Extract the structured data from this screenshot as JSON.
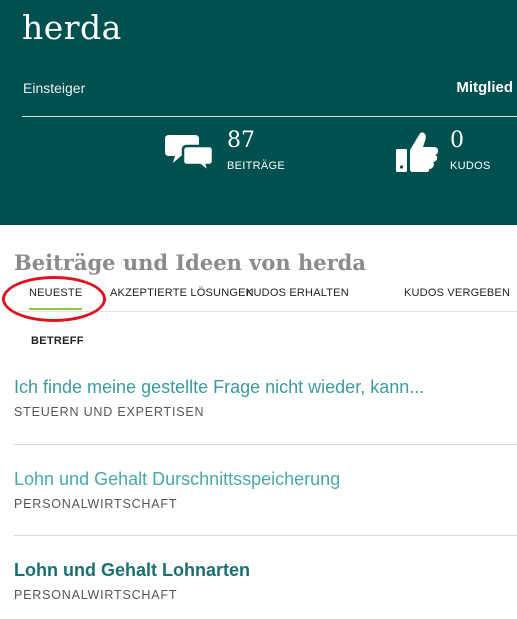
{
  "profile": {
    "username": "herda",
    "rank": "Einsteiger",
    "role": "Mitglied",
    "stats": {
      "posts_count": "87",
      "posts_label": "BEITRÄGE",
      "kudos_count": "0",
      "kudos_label": "KUDOS"
    }
  },
  "icons": {
    "posts": "speech-bubbles-icon",
    "kudos": "thumbs-up-icon"
  },
  "colors": {
    "hero_background": "#005050",
    "tab_active_underline": "#8cc63f",
    "annotation_circle": "#e0141e",
    "link_teal": "#3e9a9e"
  },
  "section": {
    "title": "Beiträge und Ideen von herda",
    "tabs": [
      {
        "label": "NEUESTE",
        "active": true
      },
      {
        "label": "AKZEPTIERTE LÖSUNGEN",
        "active": false
      },
      {
        "label": "KUDOS ERHALTEN",
        "active": false
      },
      {
        "label": "KUDOS VERGEBEN",
        "active": false
      }
    ],
    "column_header": "BETREFF"
  },
  "posts": [
    {
      "title": "Ich finde meine gestellte Frage nicht wieder, kann...",
      "board": "STEUERN UND EXPERTISEN"
    },
    {
      "title": "Lohn und Gehalt Durschnittsspeicherung",
      "board": "PERSONALWIRTSCHAFT"
    },
    {
      "title": "Lohn und Gehalt Lohnarten",
      "board": "PERSONALWIRTSCHAFT"
    }
  ]
}
